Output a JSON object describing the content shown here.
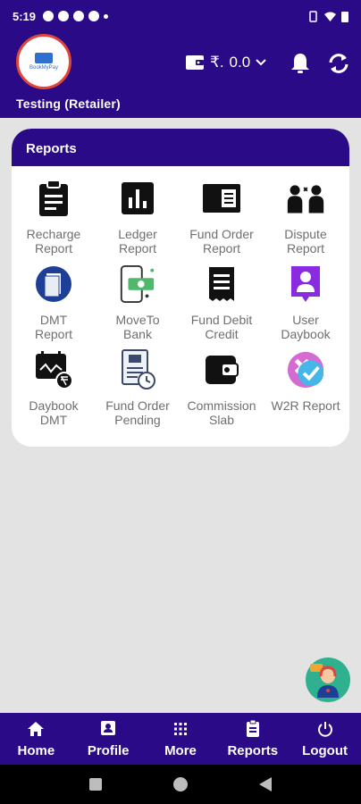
{
  "status_bar": {
    "time": "5:19"
  },
  "header": {
    "user_title": "Testing (Retailer)",
    "wallet": {
      "currency": "₹.",
      "amount": "0.0"
    },
    "logo_text": "BookMyPay"
  },
  "reports_card": {
    "title": "Reports",
    "items": [
      {
        "label": "Recharge\nReport",
        "icon": "clipboard-icon"
      },
      {
        "label": "Ledger\nReport",
        "icon": "bar-chart-icon"
      },
      {
        "label": "Fund Order\nReport",
        "icon": "newspaper-icon"
      },
      {
        "label": "Dispute\nReport",
        "icon": "dispute-icon"
      },
      {
        "label": "DMT\nReport",
        "icon": "document-circle-icon"
      },
      {
        "label": "MoveTo\nBank",
        "icon": "mobile-money-icon"
      },
      {
        "label": "Fund Debit\nCredit",
        "icon": "receipt-icon"
      },
      {
        "label": "User\nDaybook",
        "icon": "user-badge-icon"
      },
      {
        "label": "Daybook\nDMT",
        "icon": "calendar-rupee-icon"
      },
      {
        "label": "Fund Order\nPending",
        "icon": "pending-document-icon"
      },
      {
        "label": "Commission\nSlab",
        "icon": "wallet-icon"
      },
      {
        "label": "W2R Report",
        "icon": "w2r-icon"
      }
    ]
  },
  "bottom_nav": [
    {
      "label": "Home",
      "icon": "home-icon"
    },
    {
      "label": "Profile",
      "icon": "profile-icon"
    },
    {
      "label": "More",
      "icon": "grid-icon"
    },
    {
      "label": "Reports",
      "icon": "report-icon"
    },
    {
      "label": "Logout",
      "icon": "power-icon"
    }
  ],
  "colors": {
    "primary": "#2a0a86",
    "background": "#e3e3e3",
    "label": "#6f6f6f"
  }
}
